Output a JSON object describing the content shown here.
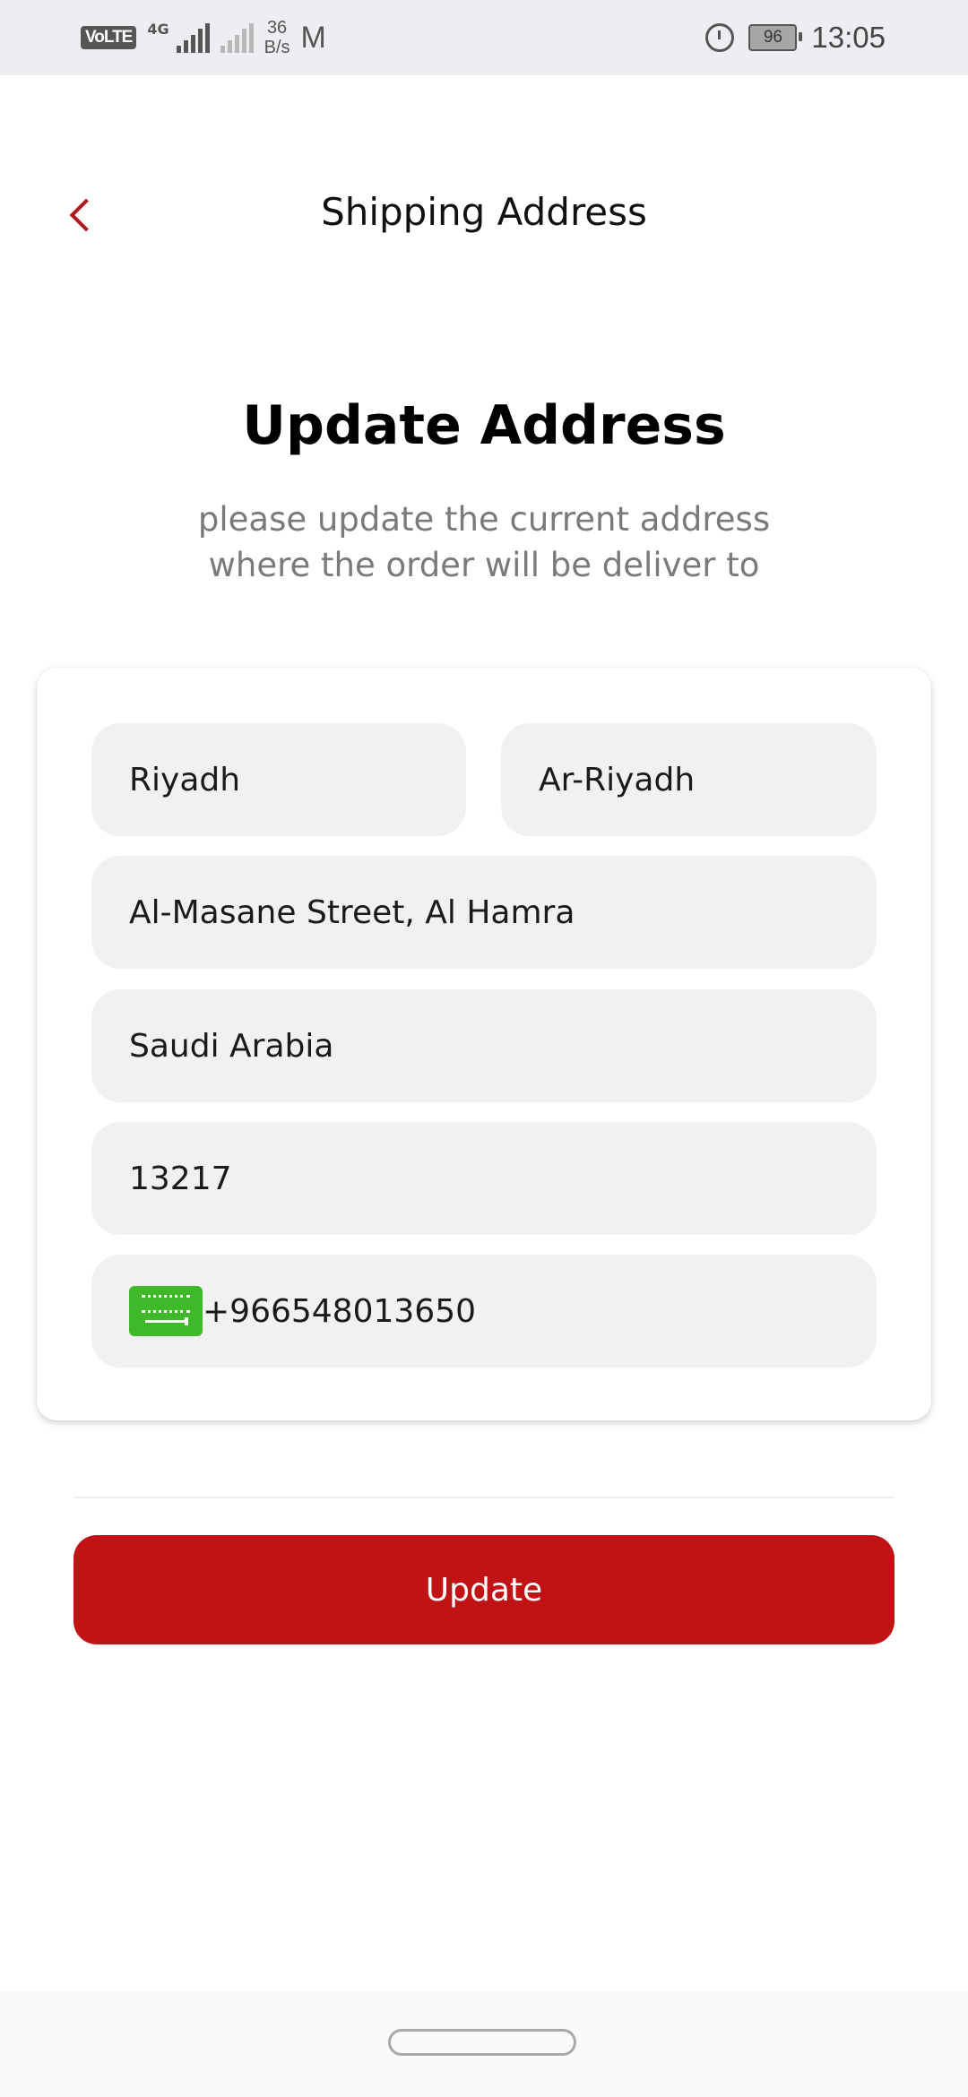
{
  "status_bar": {
    "network_badge": "VoLTE",
    "network_type": "4G",
    "data_speed_value": "36",
    "data_speed_unit": "B/s",
    "battery_level": "96",
    "time": "13:05"
  },
  "header": {
    "title": "Shipping Address"
  },
  "main": {
    "heading": "Update Address",
    "subtitle_line1": "please update the current address",
    "subtitle_line2": "where the order will be deliver to"
  },
  "form": {
    "city": "Riyadh",
    "region": "Ar-Riyadh",
    "street": "Al-Masane Street, Al Hamra",
    "country": "Saudi Arabia",
    "postal_code": "13217",
    "phone": "+966548013650"
  },
  "actions": {
    "update_label": "Update"
  },
  "colors": {
    "accent": "#c11216",
    "field_bg": "#f1f1f1",
    "flag_green": "#3fb82a"
  }
}
